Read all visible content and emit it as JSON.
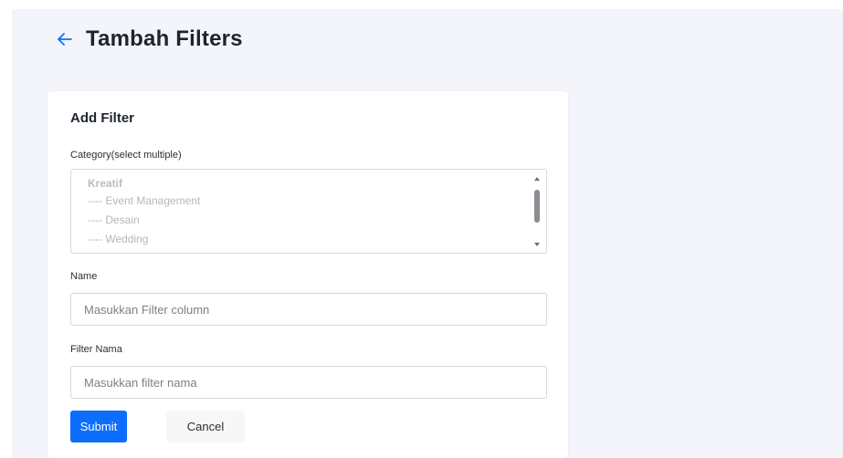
{
  "header": {
    "back_icon": "arrow-left-icon",
    "title": "Tambah Filters"
  },
  "card": {
    "title": "Add Filter",
    "category": {
      "label": "Category(select multiple)",
      "options": [
        {
          "label": "Kreatif",
          "type": "group"
        },
        {
          "label": "---- Event Management",
          "type": "child"
        },
        {
          "label": "---- Desain",
          "type": "child"
        },
        {
          "label": "---- Wedding",
          "type": "child"
        }
      ]
    },
    "name": {
      "label": "Name",
      "placeholder": "Masukkan Filter column",
      "value": ""
    },
    "filter_nama": {
      "label": "Filter Nama",
      "placeholder": "Masukkan filter nama",
      "value": ""
    },
    "buttons": {
      "submit": "Submit",
      "cancel": "Cancel"
    }
  },
  "colors": {
    "primary": "#0d6efd",
    "page_background": "#f3f5fa",
    "back_arrow": "#0d6efd"
  }
}
